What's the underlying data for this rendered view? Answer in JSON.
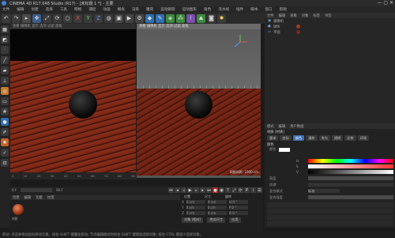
{
  "titlebar": {
    "title": "CINEMA 4D R17.048 Studio (R17) - [未标题 1 *] - 主要"
  },
  "menu": [
    "文件",
    "编辑",
    "创建",
    "选择",
    "工具",
    "网格",
    "捕捉",
    "动画",
    "模拟",
    "渲染",
    "雕刻",
    "运动跟踪",
    "运动图形",
    "角色",
    "流水线",
    "插件",
    "脚本",
    "窗口",
    "帮助"
  ],
  "toolbar_icons": [
    "undo-icon",
    "redo-icon",
    "select-icon",
    "move-icon",
    "scale-icon",
    "rotate-icon",
    "object-icon",
    "x-axis-icon",
    "y-axis-icon",
    "z-axis-icon",
    "world-icon",
    "render-view-icon",
    "render-icon",
    "render-settings-icon",
    "cube-icon",
    "pen-icon",
    "subdivision-icon",
    "array-icon",
    "deformer-icon",
    "scene-icon",
    "camera-icon",
    "light-icon"
  ],
  "left_tools": [
    "polygon-icon",
    "texture-icon",
    "point-icon",
    "edge-icon",
    "poly-mode-icon",
    "axis-icon",
    "snap-icon",
    "workplane-icon",
    "grid-icon",
    "sculpt-icon",
    "brush-icon",
    "paint-icon",
    "enable-icon",
    "lock-icon"
  ],
  "viewport_left": {
    "menu": "查看 摄像机 显示 选项 过滤 面板",
    "label": "透视视图"
  },
  "viewport_right": {
    "menu": "查看 摄像机 显示 选项 过滤 面板",
    "footer": "网格间距: 1000 cm"
  },
  "objects": {
    "menu": [
      "文件",
      "编辑",
      "查看",
      "对象",
      "标签",
      "书签"
    ],
    "items": [
      "摄像机",
      "球体",
      "平面"
    ]
  },
  "attributes": {
    "tabs": [
      "模式",
      "编辑",
      "用户数据"
    ],
    "subtabs": [
      "基本",
      "坐标",
      "颜色",
      "漫射",
      "发光",
      "透明",
      "反射",
      "环境"
    ],
    "active_subtab": "颜色",
    "title": "材质 [材质]",
    "section": "颜色",
    "fields": [
      {
        "label": "颜色",
        "value": ""
      },
      {
        "label": "H",
        "value": "0 °"
      },
      {
        "label": "S",
        "value": "0 %"
      },
      {
        "label": "V",
        "value": "80 %"
      },
      {
        "label": "亮度",
        "value": "100 %"
      },
      {
        "label": "纹理",
        "value": ""
      },
      {
        "label": "混合模式",
        "value": "标准"
      },
      {
        "label": "混合强度",
        "value": "100 %"
      }
    ]
  },
  "timeline": {
    "start": "0 F",
    "end": "90 F",
    "current": "0 F",
    "ticks": [
      "0",
      "5",
      "10",
      "15",
      "20",
      "25",
      "30",
      "35",
      "40",
      "45",
      "50",
      "55",
      "60",
      "65",
      "70",
      "75",
      "80",
      "85",
      "90"
    ]
  },
  "material_manager": {
    "menu": [
      "创建",
      "编辑",
      "功能",
      "纹理"
    ],
    "material_name": "材质"
  },
  "coordinates": {
    "headers": [
      "位置",
      "尺寸",
      "旋转"
    ],
    "rows": [
      {
        "axis": "X",
        "pos": "0 cm",
        "size": "0 cm",
        "rot": "H 0 °"
      },
      {
        "axis": "Y",
        "pos": "0 cm",
        "size": "0 cm",
        "rot": "P 0 °"
      },
      {
        "axis": "Z",
        "pos": "0 cm",
        "size": "0 cm",
        "rot": "B 0 °"
      }
    ],
    "mode": "对象 (相对)",
    "size_mode": "绝对尺寸",
    "apply": "应用"
  },
  "status": "移动: 点击并拖动鼠标移动元素。按住 SHIFT 键量化移动; 节点编辑模式时按住 SHIFT 键增加选择对象; 按住 CTRL 键减少选择对象。"
}
